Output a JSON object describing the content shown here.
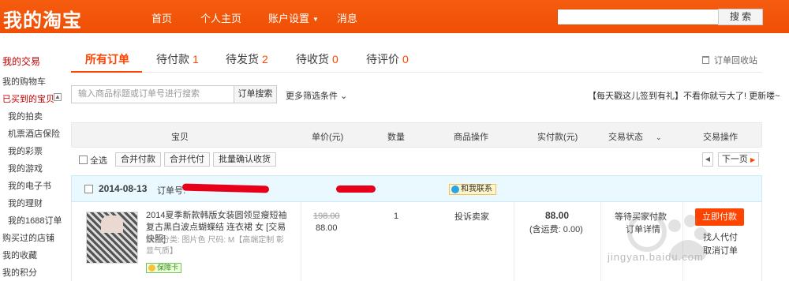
{
  "header": {
    "logo": "我的淘宝",
    "nav": [
      "首页",
      "个人主页",
      "账户设置",
      "消息"
    ],
    "search_button": "搜 索",
    "brand_color": "#f25a0e"
  },
  "sidebar": {
    "items": [
      "我的交易",
      "我的购物车",
      "已买到的宝贝",
      "我的拍卖",
      "机票酒店保险",
      "我的彩票",
      "我的游戏",
      "我的电子书",
      "我的理财",
      "我的1688订单",
      "购买过的店铺",
      "我的收藏",
      "我的积分"
    ],
    "toggle": "▲"
  },
  "tabs": [
    {
      "label": "所有订单",
      "count": ""
    },
    {
      "label": "待付款",
      "count": "1"
    },
    {
      "label": "待发货",
      "count": "2"
    },
    {
      "label": "待收货",
      "count": "0"
    },
    {
      "label": "待评价",
      "count": "0"
    }
  ],
  "recycle_label": "订单回收站",
  "filter": {
    "placeholder": "输入商品标题或订单号进行搜索",
    "search_button": "订单搜索",
    "more_filters": "更多筛选条件",
    "promo": "【每天戳这儿签到有礼】不看你就亏大了! 更新喽~"
  },
  "table_header": [
    "宝贝",
    "单价(元)",
    "数量",
    "商品操作",
    "实付款(元)",
    "交易状态",
    "交易操作"
  ],
  "select_row": {
    "select_all": "全选",
    "buttons": [
      "合并付款",
      "合并代付",
      "批量确认收货"
    ],
    "next_page": "下一页"
  },
  "order": {
    "date": "2014-08-13",
    "order_no_label": "订单号:",
    "contact_label": "和我联系",
    "product_title": "2014夏季新款韩版女装圆领显瘦短袖复古黑白波点蝴蝶结 连衣裙 女 [交易快照]",
    "spec": "颜色分类: 图片色 尺码: M【高端定制 彰显气质】",
    "badge": "保障卡",
    "original_price": "198.00",
    "price": "88.00",
    "quantity": "1",
    "complain": "投诉卖家",
    "paid": "88.00",
    "shipping": "(含运费: 0.00)",
    "status": "等待买家付款",
    "status_detail": "订单详情",
    "pay_button": "立即付款",
    "ops": [
      "找人代付",
      "取消订单"
    ]
  },
  "watermark": "jingyan.baidu.com"
}
